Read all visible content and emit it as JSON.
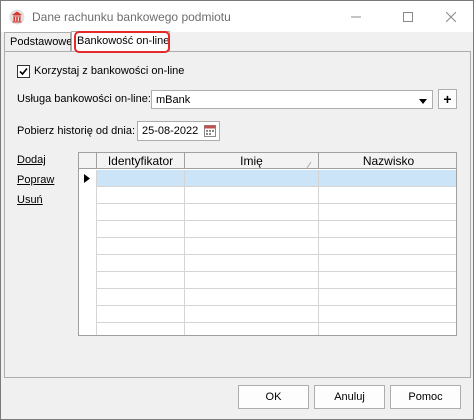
{
  "window": {
    "title": "Dane rachunku bankowego podmiotu",
    "icon": "bank-building-icon",
    "controls": [
      "minimize-icon",
      "maximize-icon",
      "close-icon"
    ]
  },
  "tabs": [
    {
      "label": "Podstawowe",
      "active": false
    },
    {
      "label": "Bankowość on-line",
      "active": true
    }
  ],
  "highlight_color": "#e32b2b",
  "form": {
    "use_online_checkbox": {
      "label": "Korzystaj z bankowości on-line",
      "checked": true
    },
    "service": {
      "label": "Usługa bankowości on-line:",
      "value": "mBank",
      "add_button": "+"
    },
    "history_from": {
      "label": "Pobierz historię od dnia:",
      "value": "25-08-2022"
    }
  },
  "actions": {
    "add": "Dodaj",
    "edit": "Popraw",
    "delete": "Usuń"
  },
  "table": {
    "columns": [
      "Identyfikator",
      "Imię",
      "Nazwisko"
    ],
    "rows": [],
    "empty_row_count": 10,
    "selected_row": 0
  },
  "footer": {
    "ok": "OK",
    "cancel": "Anuluj",
    "help": "Pomoc"
  }
}
